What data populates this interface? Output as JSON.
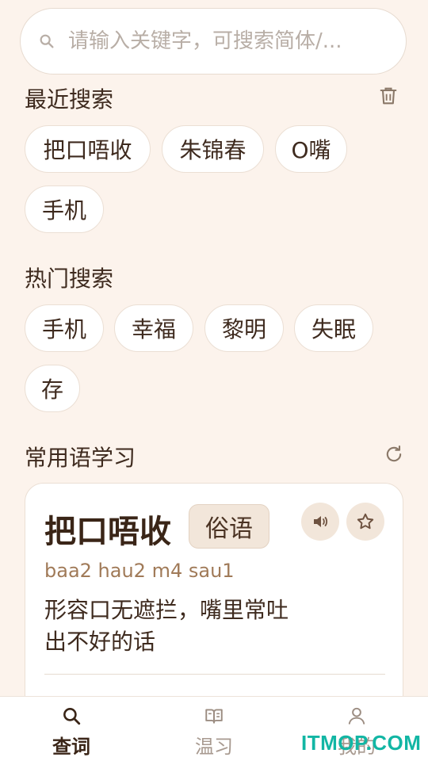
{
  "search": {
    "placeholder": "请输入关键字，可搜索简体/..."
  },
  "recent": {
    "title": "最近搜索",
    "items": [
      "把口唔收",
      "朱锦春",
      "O嘴",
      "手机"
    ]
  },
  "hot": {
    "title": "热门搜索",
    "items": [
      "手机",
      "幸福",
      "黎明",
      "失眠",
      "存"
    ]
  },
  "phrases": {
    "title": "常用语学习",
    "card": {
      "word": "把口唔收",
      "tag": "俗语",
      "pinyin": "baa2 hau2 m4 sau1",
      "meaning": "形容口无遮拦，嘴里常吐出不好的话"
    }
  },
  "nav": {
    "items": [
      {
        "label": "查词",
        "icon": "search-icon"
      },
      {
        "label": "温习",
        "icon": "book-icon"
      },
      {
        "label": "我的",
        "icon": "person-icon"
      }
    ],
    "active": "查词"
  },
  "watermark": "ITMOP.COM",
  "colors": {
    "background": "#FCF3EC",
    "text": "#3E2A1E",
    "accent": "#A07A58",
    "active_nav": "#3A2517",
    "watermark": "#12B6A4"
  }
}
